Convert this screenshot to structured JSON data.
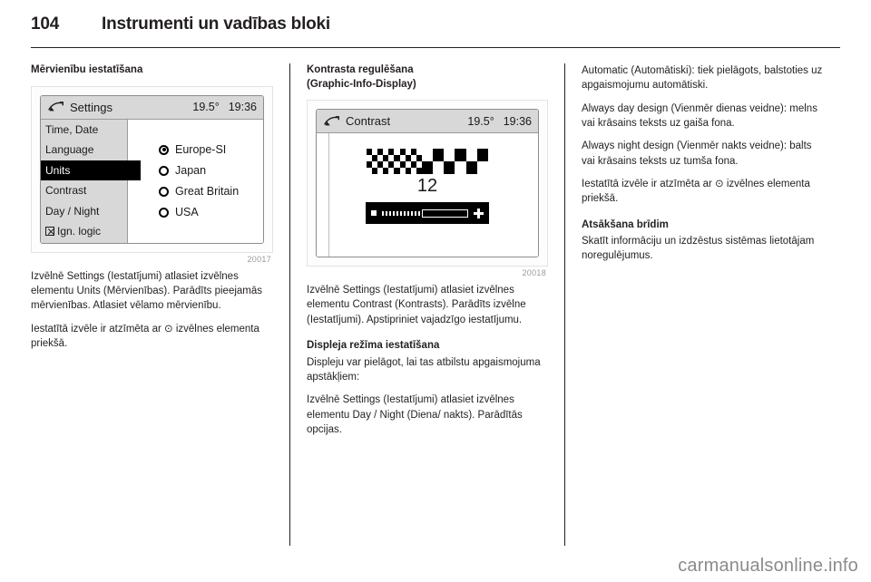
{
  "header": {
    "page_number": "104",
    "title": "Instrumenti un vadības bloki"
  },
  "left_column": {
    "heading": "Mērvienību iestatīšana",
    "figure": {
      "number": "20017",
      "display": {
        "icon": "settings-swoosh-icon",
        "title": "Settings",
        "temperature": "19.5°",
        "clock": "19:36",
        "menu_items": [
          "Time, Date",
          "Language",
          "Units",
          "Contrast",
          "Day / Night",
          "Ign. logic"
        ],
        "active_menu_item": "Units",
        "ign_logic_icon": "crossed-box-icon",
        "options": [
          {
            "label": "Europe-SI",
            "selected": true
          },
          {
            "label": "Japan",
            "selected": false
          },
          {
            "label": "Great Britain",
            "selected": false
          },
          {
            "label": "USA",
            "selected": false
          }
        ]
      }
    },
    "paragraphs": [
      "Izvēlnē Settings (Iestatījumi) atlasiet izvēlnes elementu Units (Mērvienības). Parādīts pieejamās mērvienības. Atlasiet vēlamo mērvienību.",
      "Iestatītā izvēle ir atzīmēta ar ⊙ izvēlnes elementa priekšā."
    ]
  },
  "middle_column": {
    "heading_line1": "Kontrasta regulēšana",
    "heading_line2": "(Graphic-Info-Display)",
    "figure": {
      "number": "20018",
      "display": {
        "icon": "settings-swoosh-icon",
        "title": "Contrast",
        "temperature": "19.5°",
        "clock": "19:36",
        "contrast_value": "12",
        "slider_minus_icon": "minus-icon",
        "slider_plus_icon": "plus-icon"
      }
    },
    "paragraph": "Izvēlnē Settings (Iestatījumi) atlasiet izvēlnes elementu Contrast (Kontrasts). Parādīts izvēlne (Iestatījumi). Apstipriniet vajadzīgo iestatījumu.",
    "subheading": "Displeja režīma iestatīšana",
    "paragraph2": "Displeju var pielāgot, lai tas atbilstu apgaismojuma apstākļiem:",
    "paragraph3": "Izvēlnē Settings (Iestatījumi) atlasiet izvēlnes elementu Day / Night (Diena/ nakts). Parādītās opcijas."
  },
  "right_column": {
    "paragraphs": [
      "Automatic (Automātiski): tiek pielāgots, balstoties uz apgaismojumu automātiski.",
      "Always day design (Vienmēr dienas veidne): melns vai krāsains teksts uz gaiša fona.",
      "Always night design (Vienmēr nakts veidne): balts vai krāsains teksts uz tumša fona.",
      "Iestatītā izvēle ir atzīmēta ar ⊙ izvēlnes elementa priekšā."
    ],
    "subheading": "Atsākšana brīdim",
    "paragraph_last": "Skatīt informāciju un izdzēstus sistēmas lietotājam noregulējumus."
  },
  "watermark": "carmanualsonline.info"
}
